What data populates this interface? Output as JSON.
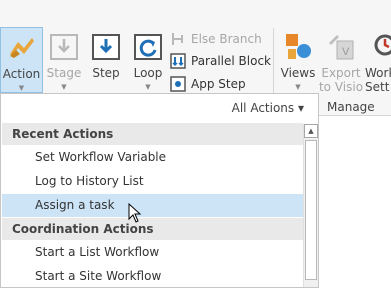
{
  "ribbon": {
    "action_label": "Action",
    "stage_label": "Stage",
    "step_label": "Step",
    "loop_label": "Loop",
    "else_branch_label": "Else Branch",
    "parallel_block_label": "Parallel Block",
    "app_step_label": "App Step",
    "views_label": "Views",
    "export_label_line1": "Export",
    "export_label_line2": "to Visio",
    "work_label_line1": "Work",
    "work_label_line2": "Sett",
    "manage_group_label": "Manage"
  },
  "dropdown": {
    "all_actions_label": "All Actions ▾",
    "sections": [
      {
        "title": "Recent Actions",
        "items": [
          "Set Workflow Variable",
          "Log to History List",
          "Assign a task"
        ]
      },
      {
        "title": "Coordination Actions",
        "items": [
          "Start a List Workflow",
          "Start a Site Workflow"
        ]
      }
    ],
    "hovered_item": "Assign a task"
  },
  "colors": {
    "active_bg": "#cde4f7",
    "accent_blue": "#1e6fb6",
    "section_bg": "#e9e9e9",
    "disabled_text": "#a6a6a6"
  }
}
